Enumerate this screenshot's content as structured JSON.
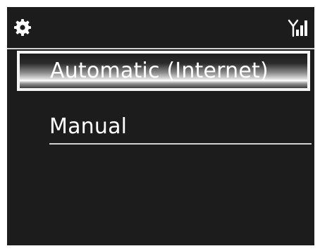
{
  "status_bar": {
    "settings_icon": "gear-icon",
    "signal_icon": "network-signal-icon"
  },
  "menu": {
    "items": [
      {
        "label": "Automatic (Internet)",
        "selected": true
      },
      {
        "label": "Manual",
        "selected": false
      }
    ]
  },
  "colors": {
    "background": "#1c1c1c",
    "text": "#ffffff",
    "highlight_border": "#f4f4f4"
  }
}
